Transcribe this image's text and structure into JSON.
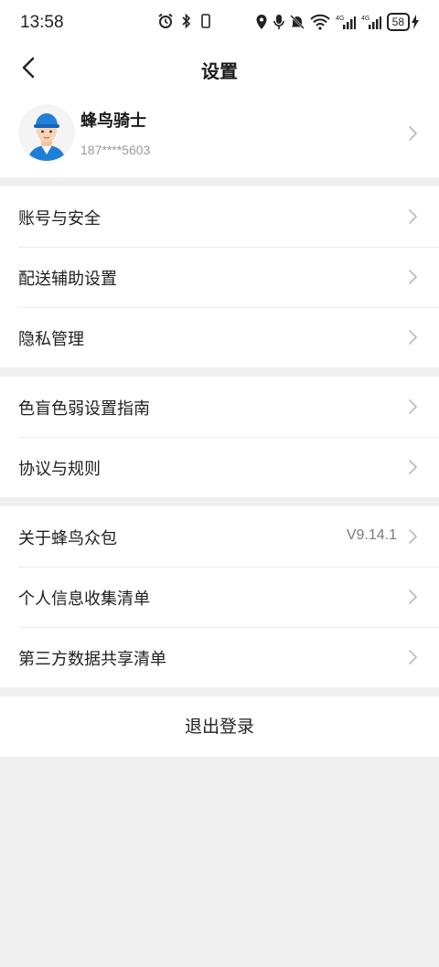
{
  "status_bar": {
    "time": "13:58",
    "network_label": "4G",
    "battery": "58"
  },
  "header": {
    "title": "设置",
    "back_icon": "chevron-left-icon"
  },
  "profile": {
    "name": "蜂鸟骑士",
    "phone": "187****5603"
  },
  "groups": [
    {
      "items": [
        {
          "label": "账号与安全"
        },
        {
          "label": "配送辅助设置"
        },
        {
          "label": "隐私管理"
        }
      ]
    },
    {
      "items": [
        {
          "label": "色盲色弱设置指南"
        },
        {
          "label": "协议与规则"
        }
      ]
    },
    {
      "items": [
        {
          "label": "关于蜂鸟众包",
          "value": "V9.14.1"
        },
        {
          "label": "个人信息收集清单"
        },
        {
          "label": "第三方数据共享清单"
        }
      ]
    }
  ],
  "logout_label": "退出登录",
  "colors": {
    "background": "#efefef",
    "card": "#ffffff",
    "chevron": "#bdbdbd",
    "avatar_helmet": "#1f7fd6"
  }
}
